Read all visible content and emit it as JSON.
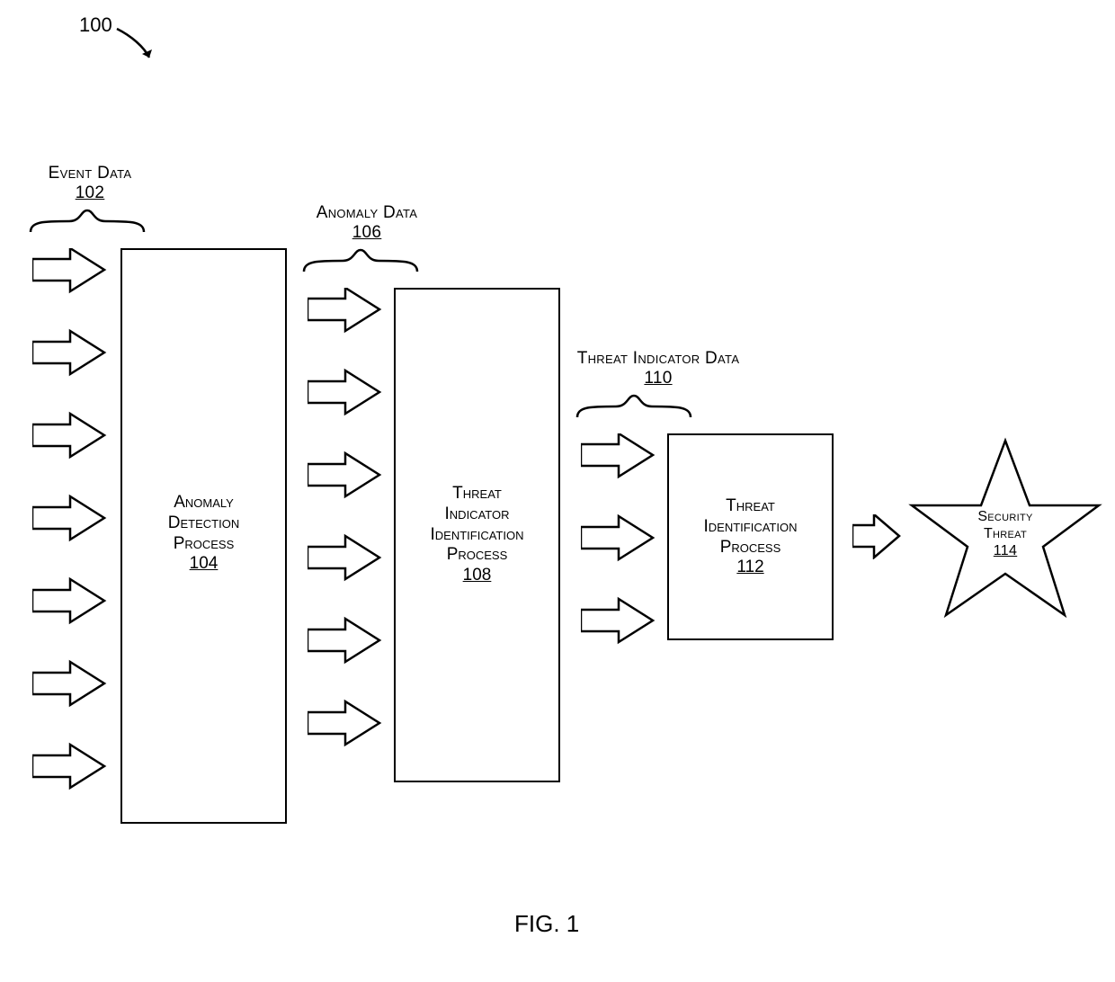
{
  "figureRef": "100",
  "figureCaption": "FIG. 1",
  "labels": {
    "eventData": {
      "title": "Event Data",
      "ref": "102"
    },
    "anomalyData": {
      "title": "Anomaly Data",
      "ref": "106"
    },
    "threatIndData": {
      "title": "Threat Indicator Data",
      "ref": "110"
    },
    "securityThreat": {
      "title1": "Security",
      "title2": "Threat",
      "ref": "114"
    }
  },
  "boxes": {
    "anomalyDetection": {
      "line1": "Anomaly",
      "line2": "Detection",
      "line3": "Process",
      "ref": "104"
    },
    "threatIndicator": {
      "line1": "Threat",
      "line2": "Indicator",
      "line3": "Identification",
      "line4": "Process",
      "ref": "108"
    },
    "threatIdent": {
      "line1": "Threat",
      "line2": "Identification",
      "line3": "Process",
      "ref": "112"
    }
  }
}
